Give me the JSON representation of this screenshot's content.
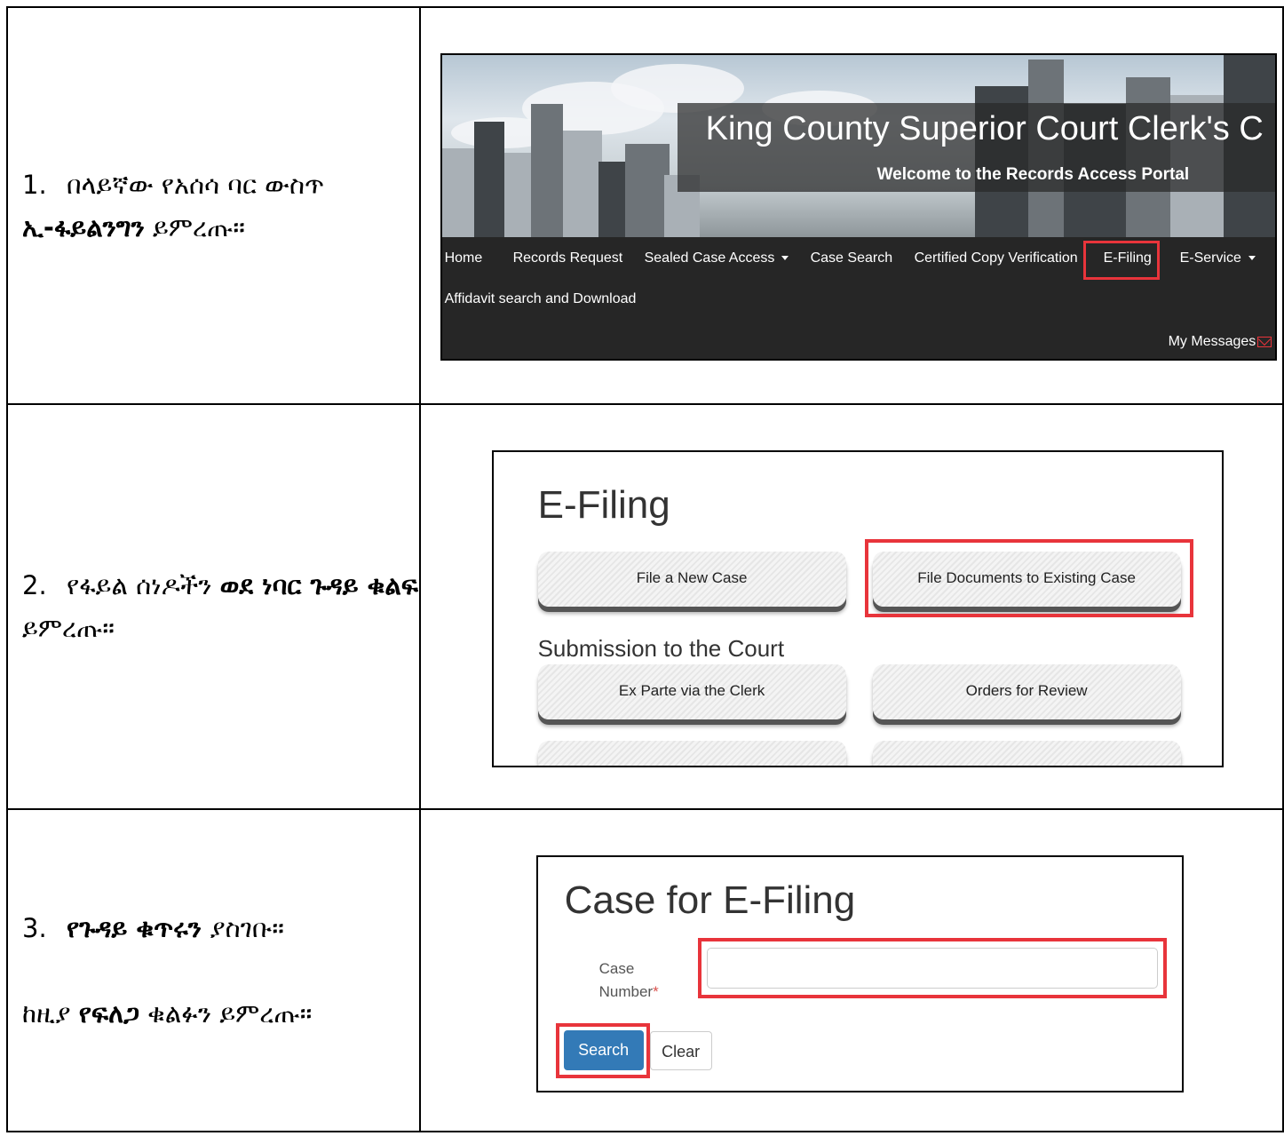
{
  "steps": [
    {
      "number": "1.",
      "text_before": "በላይኛው የአሰሳ ባር ውስጥ",
      "bold": "ኢ-ፋይልንግን",
      "text_after": " ይምረጡ።"
    },
    {
      "number": "2.",
      "text_before": "የፋይል ሰነዶችን ",
      "bold": "ወደ ነባር ጉዳይ ቁልፍ",
      "text_after": " ይምረጡ።"
    },
    {
      "number": "3.",
      "bold": "የጉዳይ ቁጥሩን",
      "text_after": " ያስገቡ።",
      "line2_before": "ከዚያ ",
      "line2_bold": "የፍለጋ",
      "line2_after": " ቁልፉን ይምረጡ።"
    }
  ],
  "shot1": {
    "site_title": "King County Superior Court Clerk's C",
    "site_subtitle": "Welcome to the Records Access Portal",
    "nav": {
      "home": "Home",
      "records_request": "Records Request",
      "sealed_case_access": "Sealed Case Access",
      "case_search": "Case Search",
      "certified_copy": "Certified Copy Verification",
      "efiling": "E-Filing",
      "eservice": "E-Service",
      "affidavit": "Affidavit search and Download",
      "my_messages": "My Messages"
    },
    "highlight_color": "#e8343b"
  },
  "shot2": {
    "title": "E-Filing",
    "file_new_case": "File a New Case",
    "file_existing": "File Documents to Existing Case",
    "submission_heading": "Submission to the Court",
    "ex_parte": "Ex Parte via the Clerk",
    "orders_review": "Orders for Review"
  },
  "shot3": {
    "title": "Case for E-Filing",
    "case_label_line1": "Case",
    "case_label_line2": "Number",
    "required_mark": "*",
    "search_button": "Search",
    "clear_button": "Clear",
    "button_color": "#337ab7"
  }
}
